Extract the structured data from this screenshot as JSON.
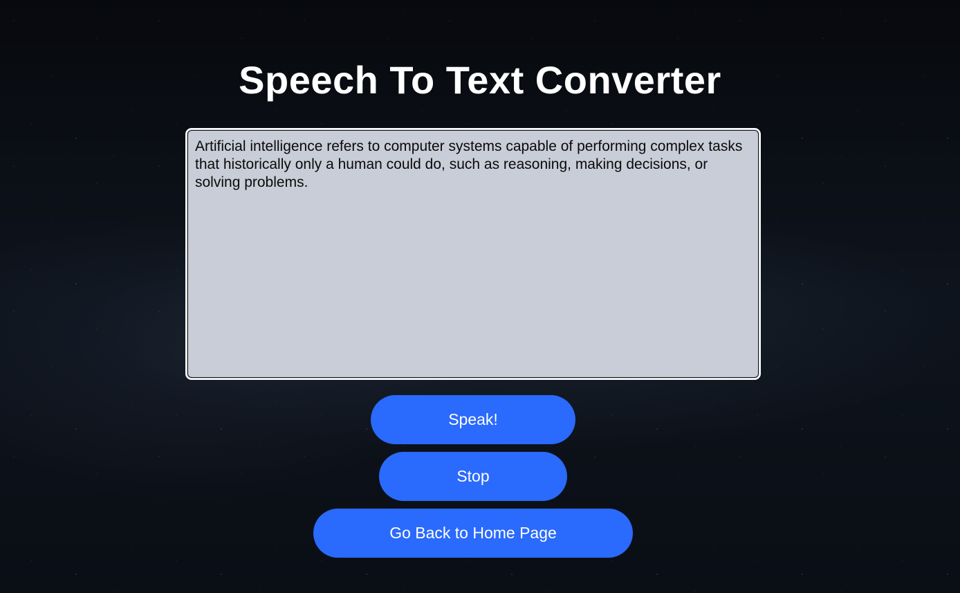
{
  "page": {
    "title": "Speech To Text Converter"
  },
  "transcript": {
    "value": "Artificial intelligence refers to computer systems capable of performing complex tasks that historically only a human could do, such as reasoning, making decisions, or solving problems."
  },
  "buttons": {
    "speak_label": "Speak!",
    "stop_label": "Stop",
    "home_label": "Go Back to Home Page"
  },
  "colors": {
    "button_bg": "#2a6afc",
    "textarea_bg": "#c9cdd7",
    "page_bg": "#0b0f16"
  }
}
